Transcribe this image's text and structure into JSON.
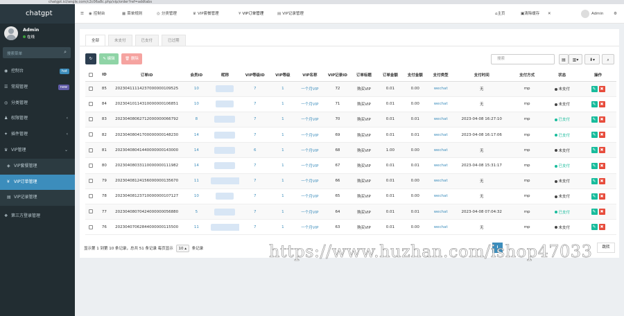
{
  "browser": {
    "url": "chatgpt.icl/angle.com/c2c06a8c.php/vip/order?ref=addtabs"
  },
  "sidebar": {
    "brand": "chatgpt",
    "user": {
      "name": "Admin",
      "status": "在线"
    },
    "search_placeholder": "搜索菜单",
    "items": [
      {
        "icon": "dashboard-icon",
        "glyph": "◉",
        "label": "控制台",
        "badge": "hot",
        "badge_color": "#3c8dbc"
      },
      {
        "icon": "rules-icon",
        "glyph": "☰",
        "label": "常规管理",
        "badge": "new",
        "badge_color": "#605ca8"
      },
      {
        "icon": "category-icon",
        "glyph": "◎",
        "label": "分类管理"
      },
      {
        "icon": "permission-icon",
        "glyph": "♟",
        "label": "权限管理",
        "chevron": "‹"
      },
      {
        "icon": "plugin-icon",
        "glyph": "✦",
        "label": "插件管理",
        "chevron": "‹"
      },
      {
        "icon": "vip-icon",
        "glyph": "♛",
        "label": "VIP管理",
        "chevron": "⌄"
      },
      {
        "icon": "vip-package-icon",
        "glyph": "◈",
        "label": "VIP套餐管理",
        "sub": true
      },
      {
        "icon": "vip-order-icon",
        "glyph": "¥",
        "label": "VIP订单管理",
        "sub": true,
        "active": true
      },
      {
        "icon": "vip-record-icon",
        "glyph": "▤",
        "label": "VIP记录管理",
        "sub": true
      },
      {
        "icon": "third-party-icon",
        "glyph": "❖",
        "label": "第三方登录管理"
      }
    ]
  },
  "topnav": {
    "tabs": [
      {
        "glyph": "◉",
        "label": "控制台"
      },
      {
        "glyph": "▦",
        "label": "菜单规则"
      },
      {
        "glyph": "◎",
        "label": "分类管理"
      },
      {
        "glyph": "♛",
        "label": "VIP套餐管理"
      },
      {
        "glyph": "¥",
        "label": "VIP订单管理"
      },
      {
        "glyph": "▤",
        "label": "VIP记录管理"
      }
    ],
    "home": "主页",
    "clear_cache": "清除缓存",
    "user": "Admin"
  },
  "filter_tabs": [
    "全部",
    "未支付",
    "已支付",
    "已过期"
  ],
  "toolbar": {
    "edit": "编辑",
    "delete": "删除",
    "search_placeholder": "搜索"
  },
  "table": {
    "columns": [
      "ID",
      "订单ID",
      "会员ID",
      "昵称",
      "VIP等级ID",
      "VIP等级",
      "VIP名称",
      "VIP记录ID",
      "订单标题",
      "订单金额",
      "支付金额",
      "支付类型",
      "支付时间",
      "支付方式",
      "状态",
      "操作"
    ],
    "rows": [
      {
        "id": "85",
        "order_id": "20230411114237000000109525",
        "member_id": "10",
        "nick_w": 26,
        "level_id": "7",
        "level": "1",
        "vip_name": "一个月VIP",
        "record_id": "72",
        "title": "购买VIP",
        "amount": "0.01",
        "paid": "0.00",
        "pay_type": "wechat",
        "pay_time": "无",
        "method": "mp",
        "status": "未支付",
        "paid_flag": false
      },
      {
        "id": "84",
        "order_id": "20230410114310000000106851",
        "member_id": "10",
        "nick_w": 26,
        "level_id": "7",
        "level": "1",
        "vip_name": "一个月VIP",
        "record_id": "71",
        "title": "购买VIP",
        "amount": "0.01",
        "paid": "0.00",
        "pay_type": "wechat",
        "pay_time": "无",
        "method": "mp",
        "status": "未支付",
        "paid_flag": false
      },
      {
        "id": "83",
        "order_id": "20230408062712000000066792",
        "member_id": "8",
        "nick_w": 30,
        "level_id": "7",
        "level": "1",
        "vip_name": "一个月VIP",
        "record_id": "70",
        "title": "购买VIP",
        "amount": "0.01",
        "paid": "0.01",
        "pay_type": "wechat",
        "pay_time": "2023-04-08 16:27:10",
        "method": "mp",
        "status": "已支付",
        "paid_flag": true
      },
      {
        "id": "82",
        "order_id": "20230408041700000000148230",
        "member_id": "14",
        "nick_w": 30,
        "level_id": "7",
        "level": "1",
        "vip_name": "一个月VIP",
        "record_id": "69",
        "title": "购买VIP",
        "amount": "0.01",
        "paid": "0.01",
        "pay_type": "wechat",
        "pay_time": "2023-04-08 16:17:06",
        "method": "mp",
        "status": "已支付",
        "paid_flag": true
      },
      {
        "id": "81",
        "order_id": "20230408041440000000143000",
        "member_id": "14",
        "nick_w": 30,
        "level_id": "6",
        "level": "1",
        "vip_name": "一个月VIP",
        "record_id": "68",
        "title": "购买VIP",
        "amount": "1.00",
        "paid": "0.00",
        "pay_type": "wechat",
        "pay_time": "无",
        "method": "mp",
        "status": "未支付",
        "paid_flag": false
      },
      {
        "id": "80",
        "order_id": "20230408033110000000111982",
        "member_id": "14",
        "nick_w": 30,
        "level_id": "7",
        "level": "1",
        "vip_name": "一个月VIP",
        "record_id": "67",
        "title": "购买VIP",
        "amount": "0.01",
        "paid": "0.01",
        "pay_type": "wechat",
        "pay_time": "2023-04-08 15:31:17",
        "method": "mp",
        "status": "已支付",
        "paid_flag": true
      },
      {
        "id": "79",
        "order_id": "20230408124156000000135670",
        "member_id": "11",
        "nick_w": 52,
        "level_id": "7",
        "level": "1",
        "vip_name": "一个月VIP",
        "record_id": "66",
        "title": "购买VIP",
        "amount": "0.01",
        "paid": "0.00",
        "pay_type": "wechat",
        "pay_time": "无",
        "method": "mp",
        "status": "未支付",
        "paid_flag": false
      },
      {
        "id": "78",
        "order_id": "20230408123710000000107127",
        "member_id": "10",
        "nick_w": 26,
        "level_id": "7",
        "level": "1",
        "vip_name": "一个月VIP",
        "record_id": "65",
        "title": "购买VIP",
        "amount": "0.01",
        "paid": "0.00",
        "pay_type": "wechat",
        "pay_time": "无",
        "method": "mp",
        "status": "未支付",
        "paid_flag": false
      },
      {
        "id": "77",
        "order_id": "20230408070424000000056880",
        "member_id": "5",
        "nick_w": 30,
        "level_id": "7",
        "level": "1",
        "vip_name": "一个月VIP",
        "record_id": "64",
        "title": "购买VIP",
        "amount": "0.01",
        "paid": "0.01",
        "pay_type": "wechat",
        "pay_time": "2023-04-08 07:04:32",
        "method": "mp",
        "status": "已支付",
        "paid_flag": true
      },
      {
        "id": "76",
        "order_id": "20230407062844000000115500",
        "member_id": "11",
        "nick_w": 52,
        "level_id": "7",
        "level": "1",
        "vip_name": "一个月VIP",
        "record_id": "63",
        "title": "购买VIP",
        "amount": "0.01",
        "paid": "0.00",
        "pay_type": "wechat",
        "pay_time": "无",
        "method": "mp",
        "status": "未支付",
        "paid_flag": false
      }
    ]
  },
  "footer": {
    "summary": "显示第 1 到第 10 条记录，总共 51 条记录 每页显示",
    "per_page": "10",
    "per_page_suffix": "条记录",
    "pager_info": "i",
    "pager_next": "跳转"
  },
  "watermark": "https://www.huzhan.com/ishop47033",
  "colors": {
    "sidebar": "#222d32",
    "accent": "#3c8dbc",
    "success": "#18bc9c",
    "danger": "#e74c3c",
    "edit_btn": "#8fd4a6",
    "delete_btn": "#f5a3a0",
    "refresh_btn": "#2c3e50"
  }
}
